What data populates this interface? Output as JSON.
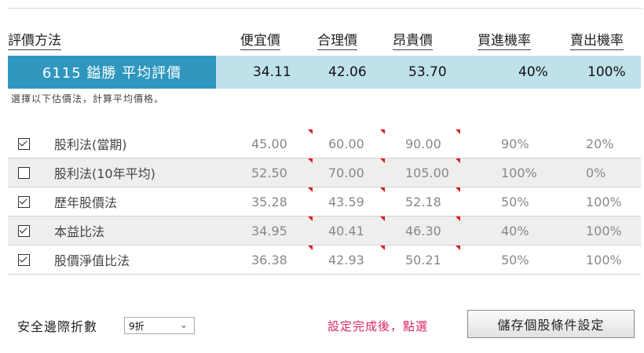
{
  "header": {
    "method": "評價方法",
    "cheap": "便宜價",
    "fair": "合理價",
    "expensive": "昂貴價",
    "buy_rate": "買進機率",
    "sell_rate": "賣出機率"
  },
  "average": {
    "label": "6115 鎰勝  平均評價",
    "cheap": "34.11",
    "fair": "42.06",
    "expensive": "53.70",
    "buy_rate": "40%",
    "sell_rate": "100%"
  },
  "note": "選擇以下估價法，計算平均價格。",
  "methods": [
    {
      "checked": true,
      "name": "股利法(當期)",
      "cheap": "45.00",
      "fair": "60.00",
      "expensive": "90.00",
      "buy_rate": "90%",
      "sell_rate": "20%"
    },
    {
      "checked": false,
      "name": "股利法(10年平均)",
      "cheap": "52.50",
      "fair": "70.00",
      "expensive": "105.00",
      "buy_rate": "100%",
      "sell_rate": "0%"
    },
    {
      "checked": true,
      "name": "歷年股價法",
      "cheap": "35.28",
      "fair": "43.59",
      "expensive": "52.18",
      "buy_rate": "50%",
      "sell_rate": "100%"
    },
    {
      "checked": true,
      "name": "本益比法",
      "cheap": "34.95",
      "fair": "40.41",
      "expensive": "46.30",
      "buy_rate": "40%",
      "sell_rate": "100%"
    },
    {
      "checked": true,
      "name": "股價淨值比法",
      "cheap": "36.38",
      "fair": "42.93",
      "expensive": "50.21",
      "buy_rate": "50%",
      "sell_rate": "100%"
    }
  ],
  "footer": {
    "safety_label": "安全邊際折數",
    "safety_value": "9折",
    "hint": "設定完成後，點選",
    "save_button": "儲存個股條件設定"
  },
  "colors": {
    "average_label_bg": "#2f97be",
    "average_row_bg": "#bfe1ea",
    "hint_text": "#e0245e",
    "cell_marker": "#e31b1b"
  }
}
